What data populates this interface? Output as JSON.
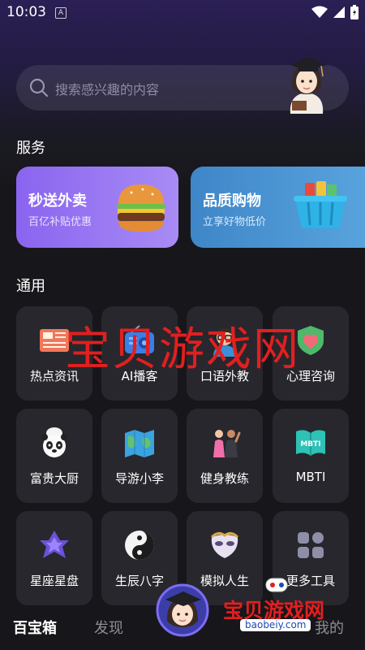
{
  "status": {
    "time": "10:03",
    "notif_badge": "A"
  },
  "search": {
    "placeholder": "搜索感兴趣的内容"
  },
  "sections": {
    "services": "服务",
    "general": "通用"
  },
  "services": [
    {
      "title": "秒送外卖",
      "subtitle": "百亿补贴优惠",
      "icon": "burger-icon"
    },
    {
      "title": "品质购物",
      "subtitle": "立享好物低价",
      "icon": "shopping-basket-icon"
    }
  ],
  "tools": [
    {
      "label": "热点资讯",
      "icon": "newspaper-icon"
    },
    {
      "label": "AI播客",
      "icon": "radio-icon"
    },
    {
      "label": "口语外教",
      "icon": "teacher-icon"
    },
    {
      "label": "心理咨询",
      "icon": "heart-shield-icon"
    },
    {
      "label": "富贵大厨",
      "icon": "panda-chef-icon"
    },
    {
      "label": "导游小李",
      "icon": "map-icon"
    },
    {
      "label": "健身教练",
      "icon": "fitness-icon"
    },
    {
      "label": "MBTI",
      "icon": "mbti-book-icon"
    },
    {
      "label": "星座星盘",
      "icon": "star-icon"
    },
    {
      "label": "生辰八字",
      "icon": "yin-yang-icon"
    },
    {
      "label": "模拟人生",
      "icon": "mask-icon"
    },
    {
      "label": "更多工具",
      "icon": "grid-icon"
    }
  ],
  "watermark": {
    "text": "宝贝游戏网",
    "logo_text": "宝贝游戏网",
    "logo_url": "baobeiy.com"
  },
  "nav": {
    "home": "百宝箱",
    "discover": "发现",
    "mine": "我的"
  },
  "colors": {
    "accent_purple": "#8a64ef",
    "accent_blue": "#3f86c8",
    "watermark_red": "#e21f1f"
  }
}
